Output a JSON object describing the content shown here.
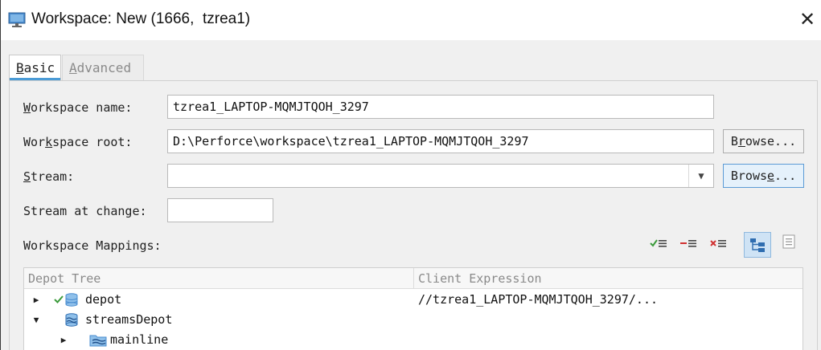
{
  "window": {
    "title": "Workspace: New (1666,  tzrea1)",
    "close_glyph": "✕"
  },
  "tabs": [
    {
      "prefix": "",
      "hotkey": "B",
      "rest": "asic",
      "active": true
    },
    {
      "prefix": "",
      "hotkey": "A",
      "rest": "dvanced",
      "active": false
    }
  ],
  "form": {
    "workspace_name": {
      "label_pre": "",
      "label_hot": "W",
      "label_post": "orkspace name:",
      "value": "tzrea1_LAPTOP-MQMJTQOH_3297"
    },
    "workspace_root": {
      "label_pre": "Wor",
      "label_hot": "k",
      "label_post": "space root:",
      "value": "D:\\Perforce\\workspace\\tzrea1_LAPTOP-MQMJTQOH_3297"
    },
    "stream": {
      "label_pre": "",
      "label_hot": "S",
      "label_post": "tream:",
      "value": ""
    },
    "stream_at_change": {
      "label": "Stream at change:",
      "value": ""
    },
    "browse_root": {
      "pre": "B",
      "hot": "r",
      "post": "owse..."
    },
    "browse_stream": {
      "pre": "Brows",
      "hot": "e",
      "post": "..."
    }
  },
  "mappings": {
    "label": "Workspace Mappings:",
    "columns": [
      "Depot Tree",
      "Client Expression"
    ],
    "rows": [
      {
        "name": "depot",
        "expression": "//tzrea1_LAPTOP-MQMJTQOH_3297/..."
      },
      {
        "name": "streamsDepot",
        "expression": ""
      },
      {
        "name": "mainline",
        "expression": ""
      }
    ],
    "toolbar_icons": [
      "include-mapping-icon",
      "exclude-mapping-icon",
      "clear-mapping-icon",
      "tree-view-icon",
      "text-view-icon"
    ]
  },
  "colors": {
    "accent": "#4a9bd6",
    "include_green": "#3a9a3a",
    "exclude_red": "#d03030",
    "depot_blue": "#4a8ccf"
  }
}
